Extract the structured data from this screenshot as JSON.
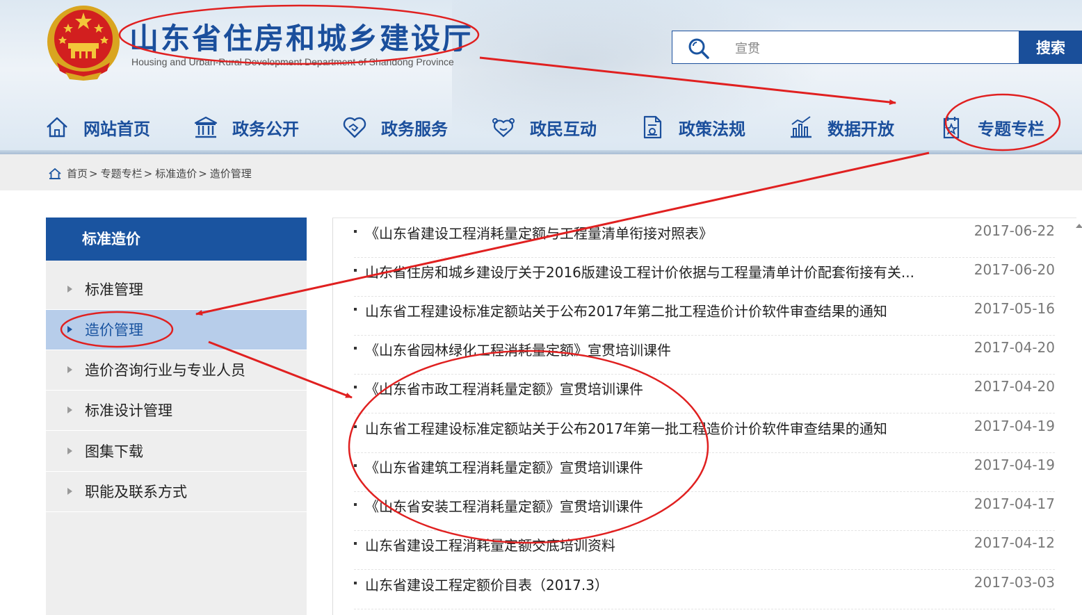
{
  "header": {
    "site_title": "山东省住房和城乡建设厅",
    "site_subtitle": "Housing and Urban-Rural Development Department of Shandong Province",
    "emblem_icon": "national-emblem",
    "search": {
      "value": "宣贯",
      "button_label": "搜索",
      "icon": "search-icon"
    }
  },
  "nav": {
    "items": [
      {
        "label": "网站首页",
        "icon": "home-icon"
      },
      {
        "label": "政务公开",
        "icon": "government-building-icon"
      },
      {
        "label": "政务服务",
        "icon": "handshake-heart-icon"
      },
      {
        "label": "政民互动",
        "icon": "interaction-icon"
      },
      {
        "label": "政策法规",
        "icon": "document-icon"
      },
      {
        "label": "数据开放",
        "icon": "data-chart-icon"
      },
      {
        "label": "专题专栏",
        "icon": "star-document-icon"
      }
    ]
  },
  "breadcrumb": {
    "items": [
      "首页",
      "专题专栏",
      "标准造价",
      "造价管理"
    ],
    "separator": ">"
  },
  "sidebar": {
    "title": "标准造价",
    "items": [
      {
        "label": "标准管理",
        "active": false
      },
      {
        "label": "造价管理",
        "active": true
      },
      {
        "label": "造价咨询行业与专业人员",
        "active": false
      },
      {
        "label": "标准设计管理",
        "active": false
      },
      {
        "label": "图集下载",
        "active": false
      },
      {
        "label": "职能及联系方式",
        "active": false
      }
    ]
  },
  "articles": [
    {
      "title": "《山东省建设工程消耗量定额与工程量清单衔接对照表》",
      "date": "2017-06-22"
    },
    {
      "title": "山东省住房和城乡建设厅关于2016版建设工程计价依据与工程量清单计价配套衔接有关...",
      "date": "2017-06-20"
    },
    {
      "title": "山东省工程建设标准定额站关于公布2017年第二批工程造价计价软件审查结果的通知",
      "date": "2017-05-16"
    },
    {
      "title": "《山东省园林绿化工程消耗量定额》宣贯培训课件",
      "date": "2017-04-20"
    },
    {
      "title": "《山东省市政工程消耗量定额》宣贯培训课件",
      "date": "2017-04-20"
    },
    {
      "title": "山东省工程建设标准定额站关于公布2017年第一批工程造价计价软件审查结果的通知",
      "date": "2017-04-19"
    },
    {
      "title": "《山东省建筑工程消耗量定额》宣贯培训课件",
      "date": "2017-04-19"
    },
    {
      "title": "《山东省安装工程消耗量定额》宣贯培训课件",
      "date": "2017-04-17"
    },
    {
      "title": "山东省建设工程消耗量定额交底培训资料",
      "date": "2017-04-12"
    },
    {
      "title": "山东省建设工程定额价目表（2017.3）",
      "date": "2017-03-03"
    }
  ],
  "colors": {
    "brand_blue": "#1a54a0",
    "annotation_red": "#e02020",
    "active_bg": "#b7cdea"
  }
}
